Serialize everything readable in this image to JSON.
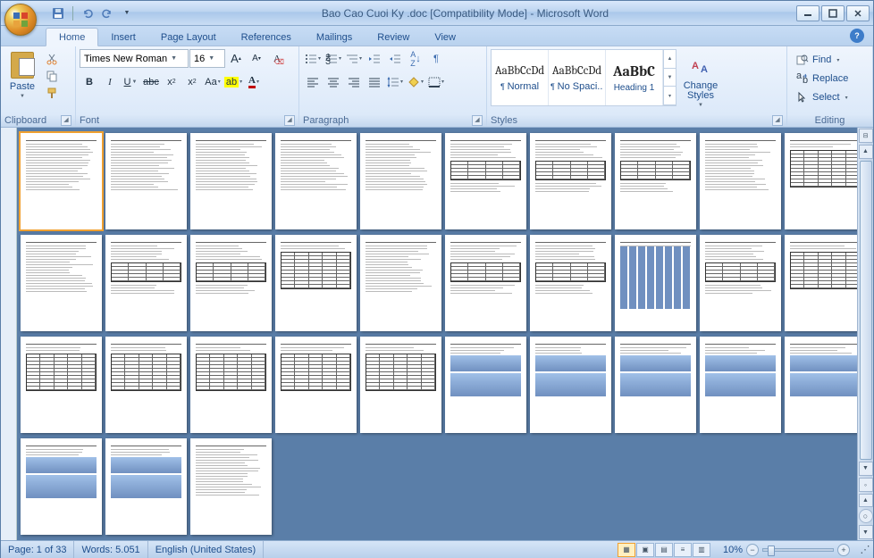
{
  "titlebar": {
    "title": "Bao Cao Cuoi Ky .doc [Compatibility Mode] - Microsoft Word"
  },
  "tabs": {
    "home": "Home",
    "insert": "Insert",
    "pagelayout": "Page Layout",
    "references": "References",
    "mailings": "Mailings",
    "review": "Review",
    "view": "View"
  },
  "ribbon": {
    "clipboard": {
      "label": "Clipboard",
      "paste": "Paste"
    },
    "font": {
      "label": "Font",
      "family": "Times New Roman",
      "size": "16"
    },
    "paragraph": {
      "label": "Paragraph"
    },
    "styles": {
      "label": "Styles",
      "preview": "AaBbCcDd",
      "preview_h": "AaBbC",
      "normal": "Normal",
      "nospacing": "No Spaci...",
      "heading1": "Heading 1",
      "change": "Change Styles"
    },
    "editing": {
      "label": "Editing",
      "find": "Find",
      "replace": "Replace",
      "select": "Select"
    }
  },
  "pages": {
    "count": 33
  },
  "status": {
    "page": "Page: 1 of 33",
    "words": "Words: 5.051",
    "lang": "English (United States)",
    "zoom": "10%"
  }
}
